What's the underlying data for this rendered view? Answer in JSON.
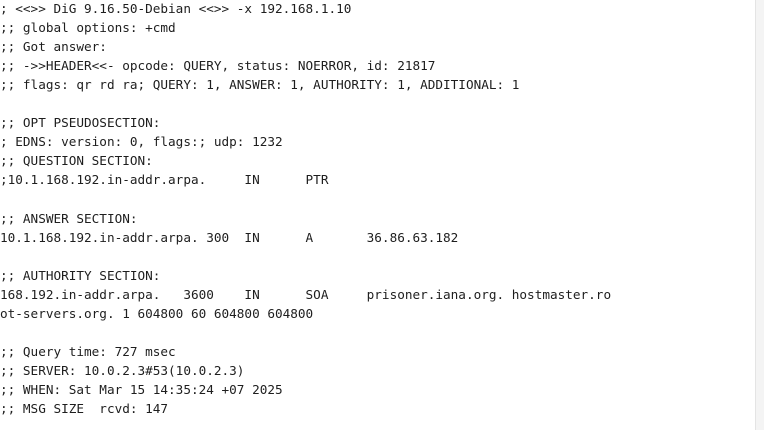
{
  "terminal": {
    "lines": [
      "; <<>> DiG 9.16.50-Debian <<>> -x 192.168.1.10",
      ";; global options: +cmd",
      ";; Got answer:",
      ";; ->>HEADER<<- opcode: QUERY, status: NOERROR, id: 21817",
      ";; flags: qr rd ra; QUERY: 1, ANSWER: 1, AUTHORITY: 1, ADDITIONAL: 1",
      "",
      ";; OPT PSEUDOSECTION:",
      "; EDNS: version: 0, flags:; udp: 1232",
      ";; QUESTION SECTION:",
      ";10.1.168.192.in-addr.arpa.     IN      PTR",
      "",
      ";; ANSWER SECTION:",
      "10.1.168.192.in-addr.arpa. 300  IN      A       36.86.63.182",
      "",
      ";; AUTHORITY SECTION:",
      "168.192.in-addr.arpa.   3600    IN      SOA     prisoner.iana.org. hostmaster.ro",
      "ot-servers.org. 1 604800 60 604800 604800",
      "",
      ";; Query time: 727 msec",
      ";; SERVER: 10.0.2.3#53(10.0.2.3)",
      ";; WHEN: Sat Mar 15 14:35:24 +07 2025",
      ";; MSG SIZE  rcvd: 147"
    ]
  }
}
